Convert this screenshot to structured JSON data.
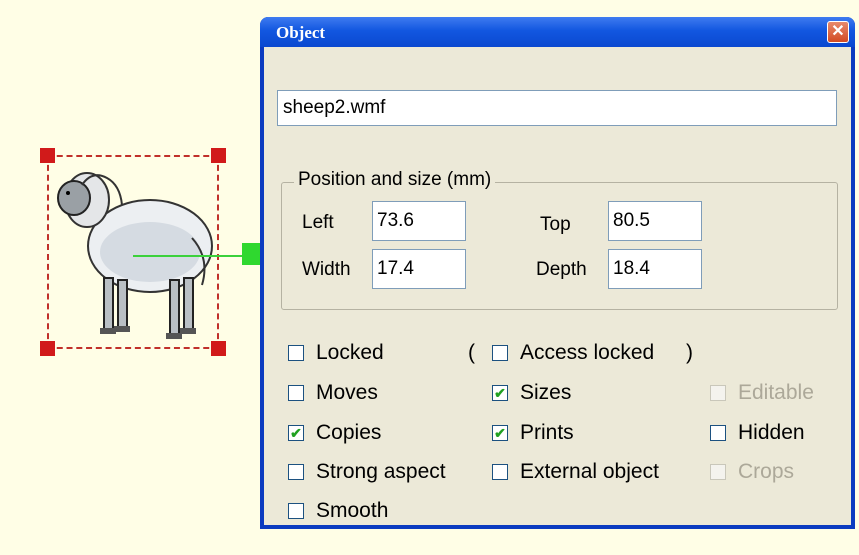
{
  "dialog": {
    "title": "Object",
    "close_glyph": "✕",
    "filename": "sheep2.wmf",
    "group_label": "Position and size (mm)",
    "fields": {
      "left": {
        "label": "Left",
        "value": "73.6"
      },
      "top": {
        "label": "Top",
        "value": "80.5"
      },
      "width": {
        "label": "Width",
        "value": "17.4"
      },
      "depth": {
        "label": "Depth",
        "value": "18.4"
      }
    },
    "paren_open": "(",
    "paren_close": ")",
    "checkboxes": {
      "locked": {
        "label": "Locked",
        "checked": false
      },
      "access_locked": {
        "label": "Access locked",
        "checked": false
      },
      "moves": {
        "label": "Moves",
        "checked": false
      },
      "sizes": {
        "label": "Sizes",
        "checked": true
      },
      "editable": {
        "label": "Editable",
        "checked": false,
        "disabled": true
      },
      "copies": {
        "label": "Copies",
        "checked": true
      },
      "prints": {
        "label": "Prints",
        "checked": true
      },
      "hidden": {
        "label": "Hidden",
        "checked": false
      },
      "strong_aspect": {
        "label": "Strong aspect",
        "checked": false
      },
      "external_object": {
        "label": "External object",
        "checked": false
      },
      "crops": {
        "label": "Crops",
        "checked": false,
        "disabled": true
      },
      "smooth": {
        "label": "Smooth",
        "checked": false
      }
    },
    "check_glyph": "✔"
  },
  "colors": {
    "canvas_bg": "#fffee6",
    "selection_handle": "#d11a1a",
    "rotation_handle": "#2fd82f",
    "title_bar": "#0a48d0"
  },
  "icons": {
    "close": "close-icon",
    "sheep": "sheep-clipart"
  }
}
